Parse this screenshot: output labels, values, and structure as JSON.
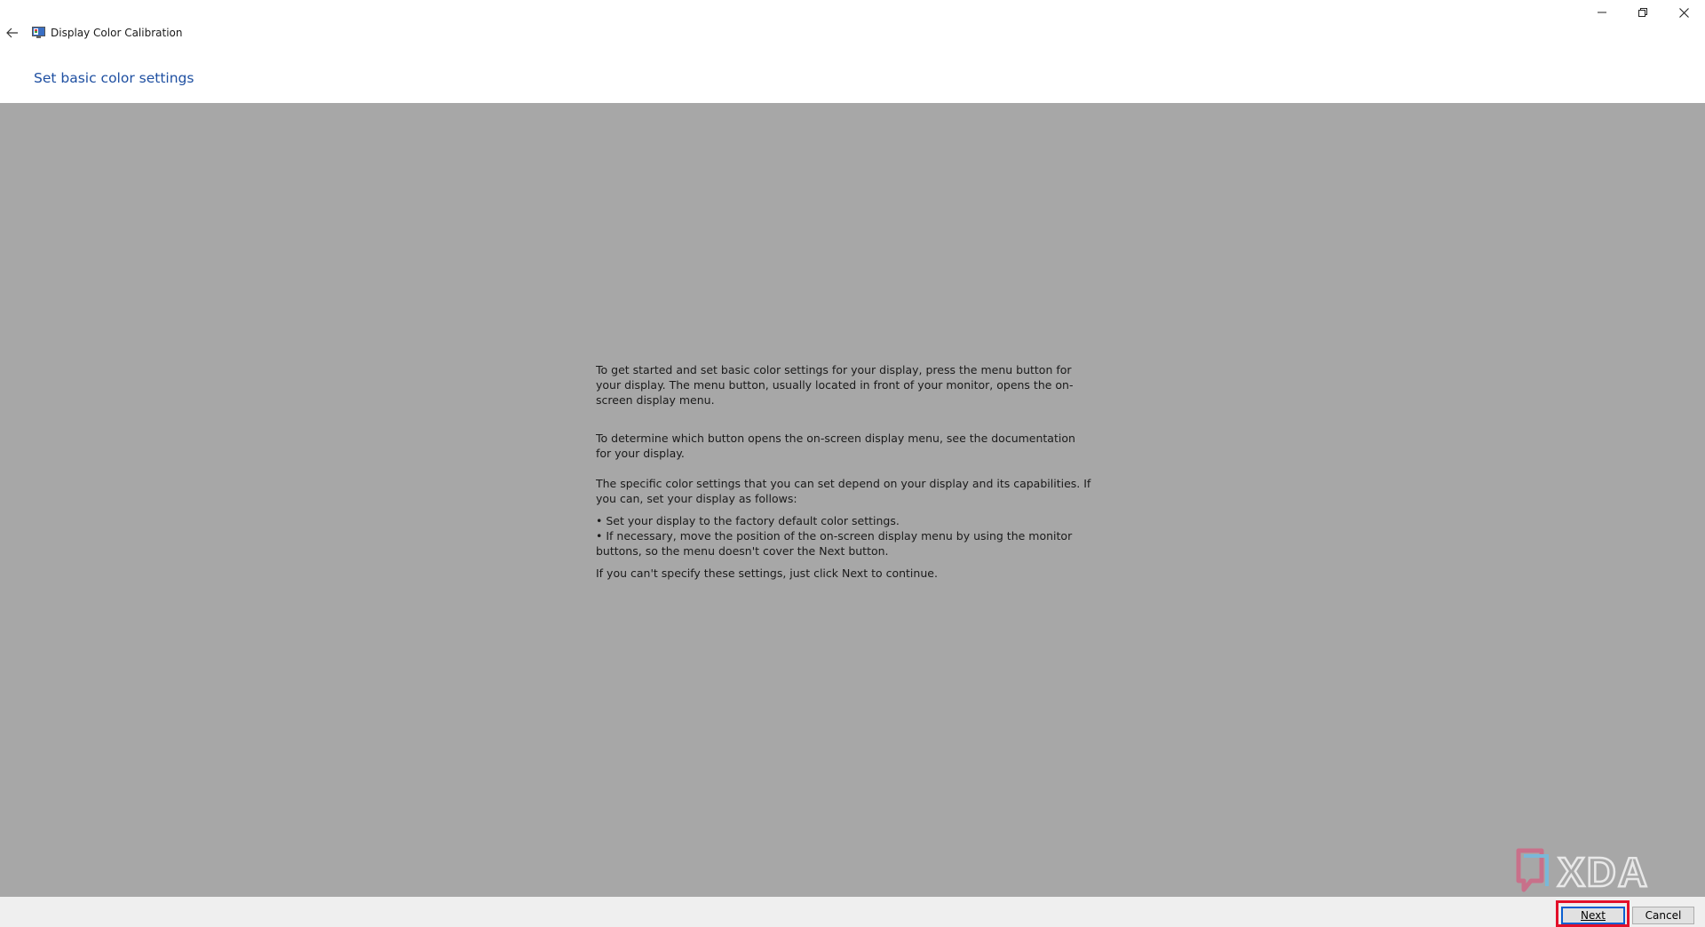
{
  "window": {
    "title": "Display Color Calibration",
    "controls": {
      "minimize_icon": "minimize-icon",
      "restore_icon": "restore-icon",
      "close_icon": "close-icon"
    }
  },
  "header": {
    "title": "Set basic color settings"
  },
  "content": {
    "background_color": "#a7a7a7",
    "paragraph1": "To get started and set basic color settings for your display, press the menu button for your display. The menu button, usually located in front of your monitor, opens the on-screen display menu.",
    "paragraph2": "To determine which button opens the on-screen display menu, see the documentation for your display.",
    "paragraph3": "The specific color settings that you can set depend on your display and its capabilities. If you can, set your display as follows:",
    "bullet1": "• Set your display to the factory default color settings.",
    "bullet2": "• If necessary, move the position of the on-screen display menu by using the monitor buttons, so the menu doesn't cover the Next button.",
    "paragraph4": "If you can't specify these settings,  just click Next to continue."
  },
  "watermark": {
    "text": "XDA"
  },
  "footer": {
    "next_label": "Next",
    "cancel_label": "Cancel",
    "highlight_color": "#e3102a"
  }
}
